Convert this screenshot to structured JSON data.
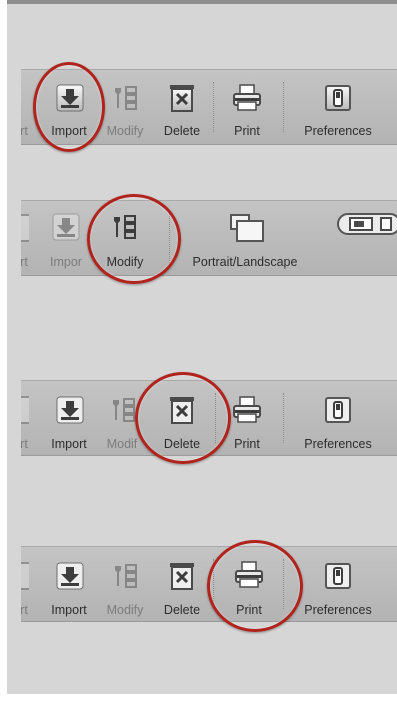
{
  "toolbar1": {
    "items": [
      {
        "label": "rt"
      },
      {
        "label": "Import"
      },
      {
        "label": "Modify"
      },
      {
        "label": "Delete"
      },
      {
        "label": "Print"
      },
      {
        "label": "Preferences"
      }
    ]
  },
  "toolbar2": {
    "items": [
      {
        "label": "rt"
      },
      {
        "label": "Impor"
      },
      {
        "label": "Modify"
      },
      {
        "label": "Portrait/Landscape"
      }
    ]
  },
  "toolbar3": {
    "items": [
      {
        "label": "rt"
      },
      {
        "label": "Import"
      },
      {
        "label": "Modif"
      },
      {
        "label": "Delete"
      },
      {
        "label": "Print"
      },
      {
        "label": "Preferences"
      }
    ]
  },
  "toolbar4": {
    "items": [
      {
        "label": "rt"
      },
      {
        "label": "Import"
      },
      {
        "label": "Modify"
      },
      {
        "label": "Delete"
      },
      {
        "label": "Print"
      },
      {
        "label": "Preferences"
      }
    ]
  },
  "highlight_color": "#b0241d",
  "icons": [
    "import-icon",
    "modify-icon",
    "delete-icon",
    "print-icon",
    "preferences-icon",
    "orientation-icon",
    "toggle-icon"
  ]
}
